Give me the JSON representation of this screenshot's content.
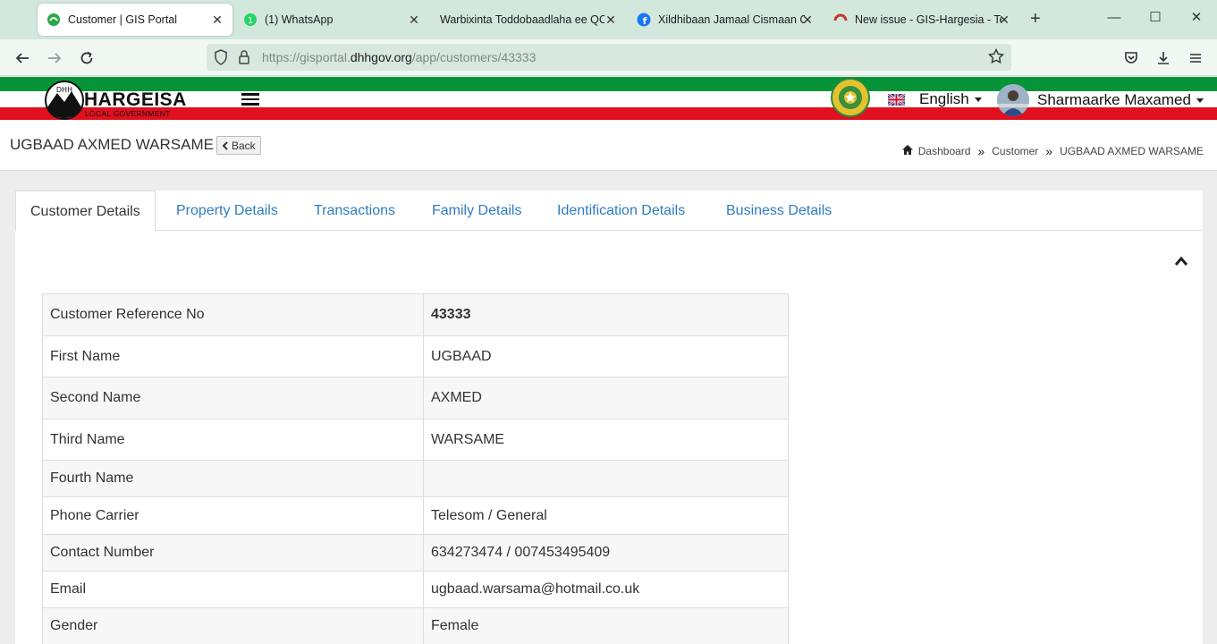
{
  "browser": {
    "tabs": [
      {
        "title": "Customer | GIS Portal",
        "active": true,
        "icon": "gis-portal-icon"
      },
      {
        "title": "(1) WhatsApp",
        "active": false,
        "icon": "whatsapp-icon"
      },
      {
        "title": "Warbixinta Toddobaadlaha ee QC.p",
        "active": false,
        "icon": "document-icon"
      },
      {
        "title": "Xildhibaan Jamaal Cismaan Cal",
        "active": false,
        "icon": "facebook-icon"
      },
      {
        "title": "New issue - GIS-Hargesia - Tear",
        "active": false,
        "icon": "gitlab-icon"
      }
    ],
    "url_prefix": "https://gisportal.",
    "url_domain": "dhhgov.org",
    "url_path": "/app/customers/43333"
  },
  "header": {
    "logo_text": "HARGEISA",
    "logo_subtext": "LOCAL GOVERNMENT",
    "logo_badge": "DHH",
    "language": "English",
    "user_name": "Sharmaarke Maxamed",
    "colors": {
      "green": "#079439",
      "white": "#ffffff",
      "red": "#e0101f"
    }
  },
  "page": {
    "title": "UGBAAD AXMED WARSAME",
    "back_label": "Back",
    "breadcrumb": [
      "Dashboard",
      "Customer",
      "UGBAAD AXMED WARSAME"
    ]
  },
  "tabs": [
    "Customer Details",
    "Property Details",
    "Transactions",
    "Family Details",
    "Identification Details",
    "Business Details"
  ],
  "details": [
    {
      "label": "Customer Reference No",
      "value": "43333"
    },
    {
      "label": "First Name",
      "value": "UGBAAD"
    },
    {
      "label": "Second Name",
      "value": "AXMED"
    },
    {
      "label": "Third Name",
      "value": "WARSAME"
    },
    {
      "label": "Fourth Name",
      "value": ""
    },
    {
      "label": "Phone Carrier",
      "value": "Telesom / General"
    },
    {
      "label": "Contact Number",
      "value": "634273474 / 007453495409"
    },
    {
      "label": "Email",
      "value": "ugbaad.warsama@hotmail.co.uk"
    },
    {
      "label": "Gender",
      "value": "Female"
    }
  ]
}
